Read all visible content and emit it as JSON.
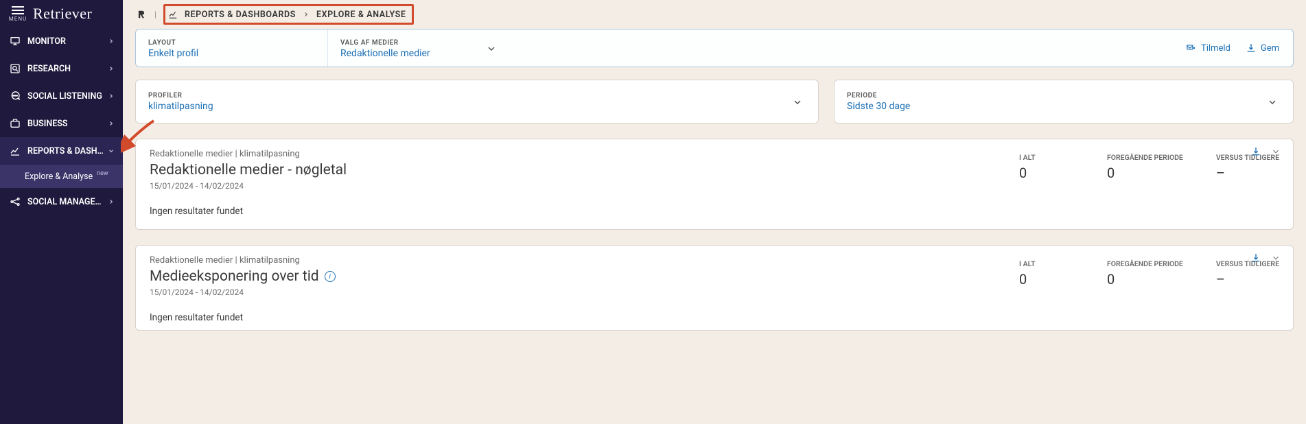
{
  "brand": "Retriever",
  "menu_label": "MENU",
  "sidebar": {
    "items": [
      {
        "label": "MONITOR"
      },
      {
        "label": "RESEARCH"
      },
      {
        "label": "SOCIAL LISTENING"
      },
      {
        "label": "BUSINESS"
      },
      {
        "label": "REPORTS & DASHBO…"
      },
      {
        "label": "SOCIAL MANAGEME…"
      }
    ],
    "sub": {
      "label": "Explore & Analyse",
      "badge": "new"
    }
  },
  "breadcrumb": {
    "a": "REPORTS & DASHBOARDS",
    "b": "EXPLORE & ANALYSE"
  },
  "filters": {
    "layout_label": "LAYOUT",
    "layout_value": "Enkelt profil",
    "media_label": "VALG AF MEDIER",
    "media_value": "Redaktionelle medier",
    "actions": {
      "subscribe": "Tilmeld",
      "save": "Gem"
    },
    "profile_label": "PROFILER",
    "profile_value": "klimatilpasning",
    "period_label": "PERIODE",
    "period_value": "Sidste 30 dage"
  },
  "stats_labels": {
    "total": "I ALT",
    "prev": "FOREGÅENDE PERIODE",
    "vs": "VERSUS TIDLIGERE"
  },
  "cards": [
    {
      "meta": "Redaktionelle medier | klimatilpasning",
      "title": "Redaktionelle medier - nøgletal",
      "dates": "15/01/2024 - 14/02/2024",
      "total": "0",
      "prev": "0",
      "vs": "–",
      "body": "Ingen resultater fundet",
      "info": false
    },
    {
      "meta": "Redaktionelle medier | klimatilpasning",
      "title": "Medieeksponering over tid",
      "dates": "15/01/2024 - 14/02/2024",
      "total": "0",
      "prev": "0",
      "vs": "–",
      "body": "Ingen resultater fundet",
      "info": true
    }
  ]
}
